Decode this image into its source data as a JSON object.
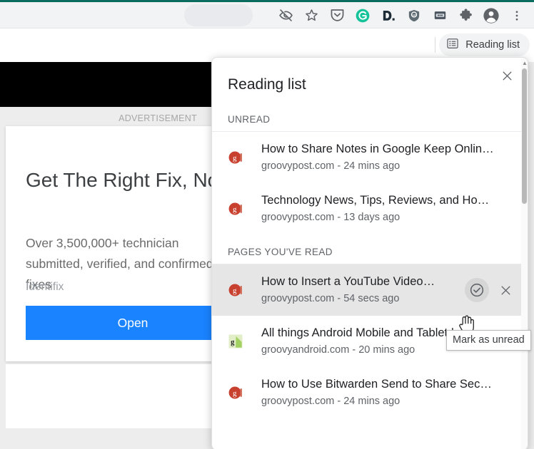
{
  "browser": {
    "toolbar_icons": [
      {
        "name": "eye-slash-icon",
        "label": "Hide passwords"
      },
      {
        "name": "star-icon",
        "label": "Bookmark this tab"
      },
      {
        "name": "pocket-icon",
        "label": "Save to Pocket"
      },
      {
        "name": "grammarly-icon",
        "label": "Grammarly"
      },
      {
        "name": "dashlane-icon",
        "label": "Dashlane"
      },
      {
        "name": "ublock-origin-icon",
        "label": "uBlock Origin"
      },
      {
        "name": "password-manager-icon",
        "label": "Password manager"
      },
      {
        "name": "extensions-puzzle-icon",
        "label": "Extensions"
      },
      {
        "name": "profile-avatar-icon",
        "label": "Profile"
      },
      {
        "name": "chrome-menu-icon",
        "label": "Customize and control Google Chrome"
      }
    ],
    "reading_list_chip": {
      "label": "Reading list",
      "icon": "reading-list-icon"
    }
  },
  "page_content": {
    "ad_label": "ADVERTISEMENT",
    "ad_headline": "Get The Right Fix, Now",
    "ad_body": "Over 3,500,000+ technician submitted, verified, and confirmed fixes",
    "ad_brand": "Identifix",
    "ad_cta": "Open"
  },
  "panel": {
    "title": "Reading list",
    "close_label": "Close",
    "close_icon": "close-icon",
    "sections": [
      {
        "header": "UNREAD",
        "items": [
          {
            "title": "How to Share Notes in Google Keep Onlin…",
            "subtitle": "groovypost.com - 24 mins ago",
            "favicon": "groovypost-favicon",
            "active": false
          },
          {
            "title": "Technology News, Tips, Reviews, and Ho…",
            "subtitle": "groovypost.com - 13 days ago",
            "favicon": "groovypost-favicon",
            "active": false
          }
        ]
      },
      {
        "header": "PAGES YOU'VE READ",
        "items": [
          {
            "title": "How to Insert a YouTube Video…",
            "subtitle": "groovypost.com - 54 secs ago",
            "favicon": "groovypost-favicon",
            "active": true,
            "actions": [
              {
                "name": "mark-as-unread-button",
                "icon": "check-circle-icon",
                "hovered": true
              },
              {
                "name": "delete-item-button",
                "icon": "close-icon",
                "hovered": false
              }
            ]
          },
          {
            "title": "All things Android Mobile and Tablet | gro…",
            "subtitle": "groovyandroid.com - 20 mins ago",
            "favicon": "groovyandroid-favicon",
            "active": false
          },
          {
            "title": "How to Use Bitwarden Send to Share Sec…",
            "subtitle": "groovypost.com - 24 mins ago",
            "favicon": "groovypost-favicon",
            "active": false
          }
        ]
      }
    ],
    "tooltip": "Mark as unread"
  },
  "colors": {
    "accent_blue": "#1a83ff",
    "toolbar_bg": "#f1f3f4",
    "panel_bg": "#ffffff",
    "row_selected": "#e6e6e6",
    "groovypost_red": "#c8402e",
    "grammarly_green": "#15c39a",
    "top_strip_green": "#0b6b5e"
  }
}
